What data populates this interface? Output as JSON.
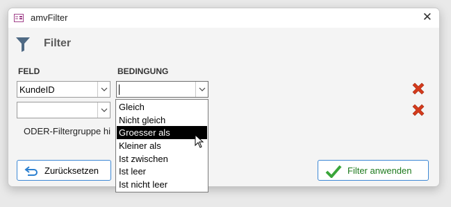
{
  "window": {
    "title": "amvFilter",
    "close_glyph": "✕",
    "icon": "form-icon"
  },
  "header": {
    "title": "Filter",
    "icon": "funnel-icon"
  },
  "columns": {
    "field": "FELD",
    "condition": "BEDINGUNG"
  },
  "rows": [
    {
      "field": "KundeID",
      "condition": ""
    },
    {
      "field": "",
      "condition": ""
    }
  ],
  "or_group_label": "ODER-Filtergruppe hi",
  "buttons": {
    "reset": {
      "label": "Zurücksetzen",
      "icon": "undo-arrow-icon"
    },
    "apply": {
      "label": "Filter anwenden",
      "icon": "checkmark-icon"
    }
  },
  "dropdown": {
    "options": [
      "Gleich",
      "Nicht gleich",
      "Groesser als",
      "Kleiner als",
      "Ist zwischen",
      "Ist leer",
      "Ist nicht leer"
    ],
    "highlighted": "Groesser als"
  },
  "colors": {
    "delete_red": "#d33a1c",
    "apply_green": "#3aa53a",
    "accent_blue": "#3c87d4"
  }
}
